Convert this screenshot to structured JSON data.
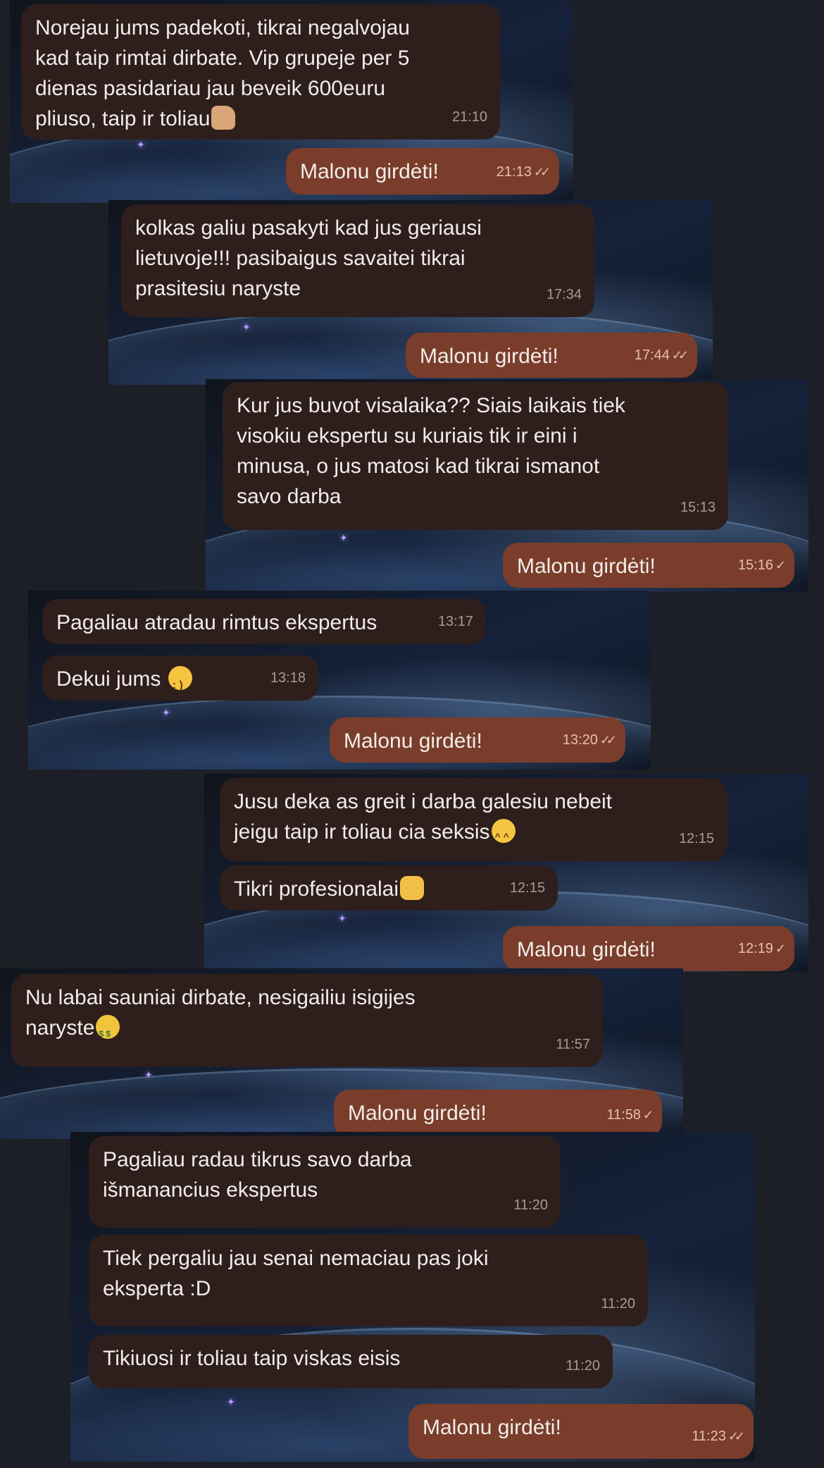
{
  "panels": [
    {
      "incoming": [
        {
          "text": "Norejau jums padekoti, tikrai negalvojau\nkad taip rimtai dirbate. Vip grupeje per 5\ndienas pasidariau jau beveik 600euru\npliuso, taip ir toliau",
          "emoji": "thumbs-up-icon",
          "time": "21:10"
        }
      ],
      "reply": {
        "text": "Malonu girdėti!",
        "time": "21:13",
        "status": "read"
      }
    },
    {
      "incoming": [
        {
          "text": "kolkas galiu pasakyti kad jus geriausi\nlietuvoje!!! pasibaigus savaitei tikrai\nprasitesiu naryste",
          "time": "17:34"
        }
      ],
      "reply": {
        "text": "Malonu girdėti!",
        "time": "17:44",
        "status": "read"
      }
    },
    {
      "incoming": [
        {
          "text": "Kur jus buvot visalaika?? Siais laikais tiek\nvisokiu ekspertu su kuriais tik ir eini i\nminusa, o jus matosi kad tikrai ismanot\nsavo darba",
          "time": "15:13"
        }
      ],
      "reply": {
        "text": "Malonu girdėti!",
        "time": "15:16",
        "status": "sent"
      }
    },
    {
      "incoming": [
        {
          "text": "Pagaliau atradau rimtus ekspertus",
          "time": "13:17"
        },
        {
          "text": "Dekui jums ",
          "emoji": "winking-face-icon",
          "time": "13:18"
        }
      ],
      "reply": {
        "text": "Malonu girdėti!",
        "time": "13:20",
        "status": "read"
      }
    },
    {
      "incoming": [
        {
          "text": "Jusu deka as greit i darba galesiu nebeit\njeigu taip ir toliau cia seksis",
          "emoji": "grinning-face-icon",
          "time": "12:15"
        },
        {
          "text": "Tikri profesionalai",
          "emoji": "clapping-hands-icon",
          "time": "12:15"
        }
      ],
      "reply": {
        "text": "Malonu girdėti!",
        "time": "12:19",
        "status": "sent"
      }
    },
    {
      "incoming": [
        {
          "text": "Nu labai sauniai dirbate, nesigailiu isigijes\nnaryste",
          "emoji": "money-mouth-face-icon",
          "time": "11:57"
        }
      ],
      "reply": {
        "text": "Malonu girdėti!",
        "time": "11:58",
        "status": "sent"
      }
    },
    {
      "incoming": [
        {
          "text": "Pagaliau radau tikrus savo darba\nišmanancius ekspertus",
          "time": "11:20"
        },
        {
          "text": "Tiek pergaliu jau senai nemaciau pas joki\neksperta :D",
          "time": "11:20"
        },
        {
          "text": "Tikiuosi ir toliau taip viskas eisis",
          "time": "11:20"
        }
      ],
      "reply": {
        "text": "Malonu girdėti!",
        "time": "11:23",
        "status": "read"
      }
    }
  ],
  "colors": {
    "incoming_bubble": "#2e1f1c",
    "outgoing_bubble": "#7a3d2b",
    "text": "#f1ede8",
    "page_background": "#1d1f26"
  }
}
